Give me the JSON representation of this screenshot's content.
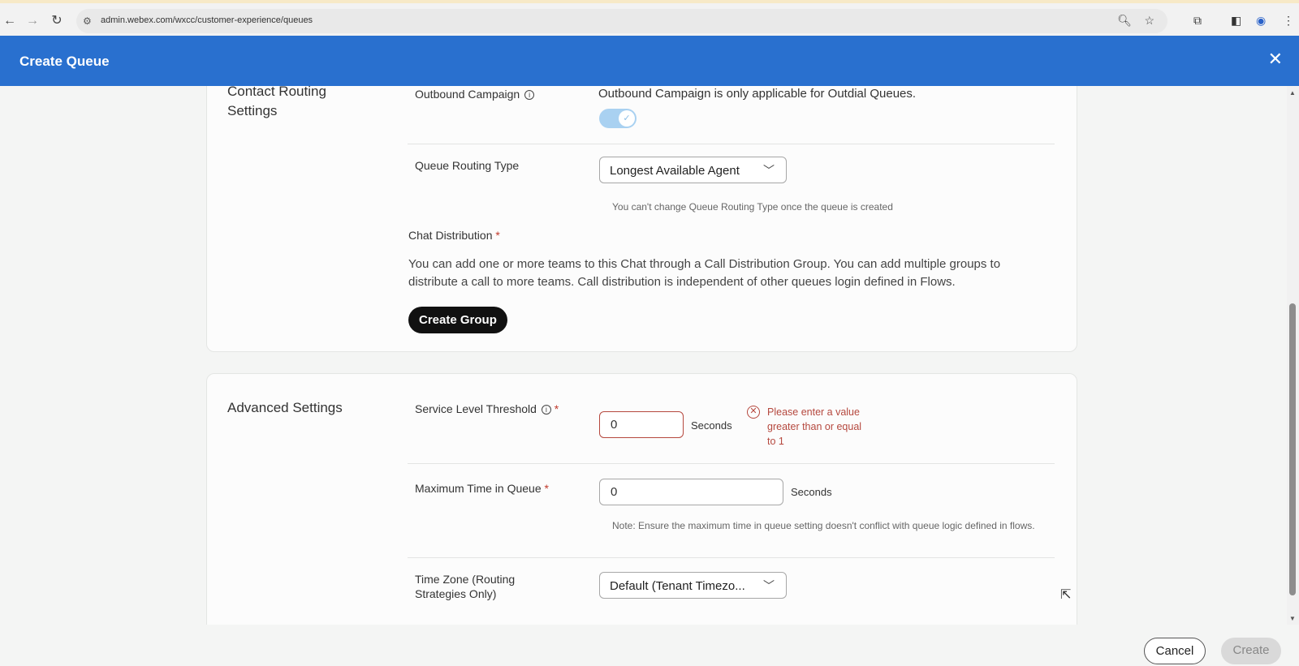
{
  "browser": {
    "url": "admin.webex.com/wxcc/customer-experience/queues"
  },
  "header": {
    "title": "Create Queue"
  },
  "contact_routing": {
    "section_title": "Contact Routing Settings",
    "outbound_campaign_label": "Outbound Campaign",
    "outbound_campaign_note": "Outbound Campaign is only applicable for Outdial Queues.",
    "outbound_campaign_enabled": true,
    "routing_type_label": "Queue Routing Type",
    "routing_type_value": "Longest Available Agent",
    "routing_type_help": "You can't change Queue Routing Type once the queue is created",
    "chat_distribution_label": "Chat Distribution",
    "chat_distribution_desc_line1": "You can add one or more teams to this Chat through a Call Distribution Group. You can add multiple groups to",
    "chat_distribution_desc_line2": "distribute a call to more teams. Call distribution is independent of other queues login defined in Flows.",
    "create_group_label": "Create Group"
  },
  "advanced": {
    "section_title": "Advanced Settings",
    "service_level_label": "Service Level Threshold",
    "service_level_value": "0",
    "service_level_unit": "Seconds",
    "service_level_error": "Please enter a value greater than or equal to 1",
    "max_time_label": "Maximum Time in Queue",
    "max_time_value": "0",
    "max_time_unit": "Seconds",
    "max_time_help": "Note: Ensure the maximum time in queue setting doesn't conflict with queue logic defined in flows.",
    "timezone_label": "Time Zone (Routing Strategies Only)",
    "timezone_value": "Default (Tenant Timezo..."
  },
  "footer": {
    "cancel_label": "Cancel",
    "create_label": "Create"
  },
  "colors": {
    "header_bg": "#2970cf",
    "error": "#b5483e",
    "toggle_on": "#a9d1f1"
  }
}
